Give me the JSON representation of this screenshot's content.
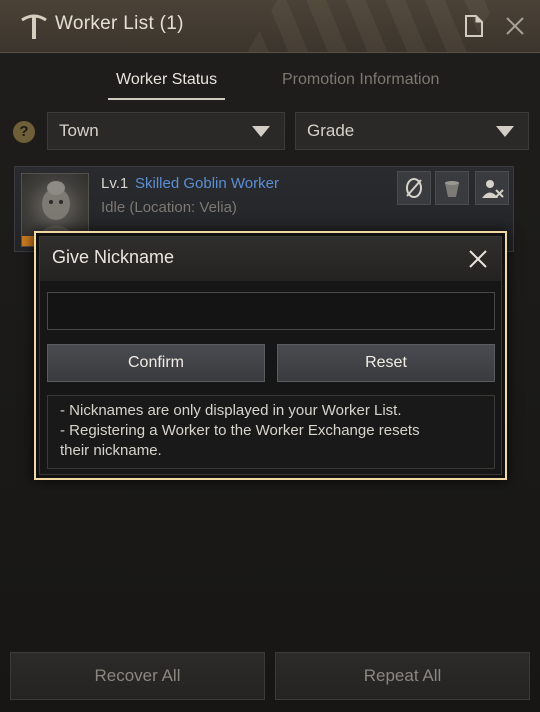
{
  "window": {
    "title": "Worker List (1)"
  },
  "tabs": [
    {
      "label": "Worker Status",
      "active": true
    },
    {
      "label": "Promotion Information",
      "active": false
    }
  ],
  "filters": {
    "help_label": "?",
    "town": "Town",
    "grade": "Grade"
  },
  "worker": {
    "level": "Lv.1",
    "name": "Skilled Goblin Worker",
    "status": "Idle (Location: Velia)",
    "name_color": "#5a8fd6",
    "stamina_fraction": 0.6
  },
  "bottom": {
    "recover_all": "Recover All",
    "repeat_all": "Repeat All"
  },
  "modal": {
    "title": "Give Nickname",
    "input_value": "",
    "confirm": "Confirm",
    "reset": "Reset",
    "notes": [
      "- Nicknames are only displayed in your Worker List.",
      "- Registering a Worker to the Worker Exchange resets",
      "their nickname."
    ],
    "border_color": "#f2d9a4"
  }
}
